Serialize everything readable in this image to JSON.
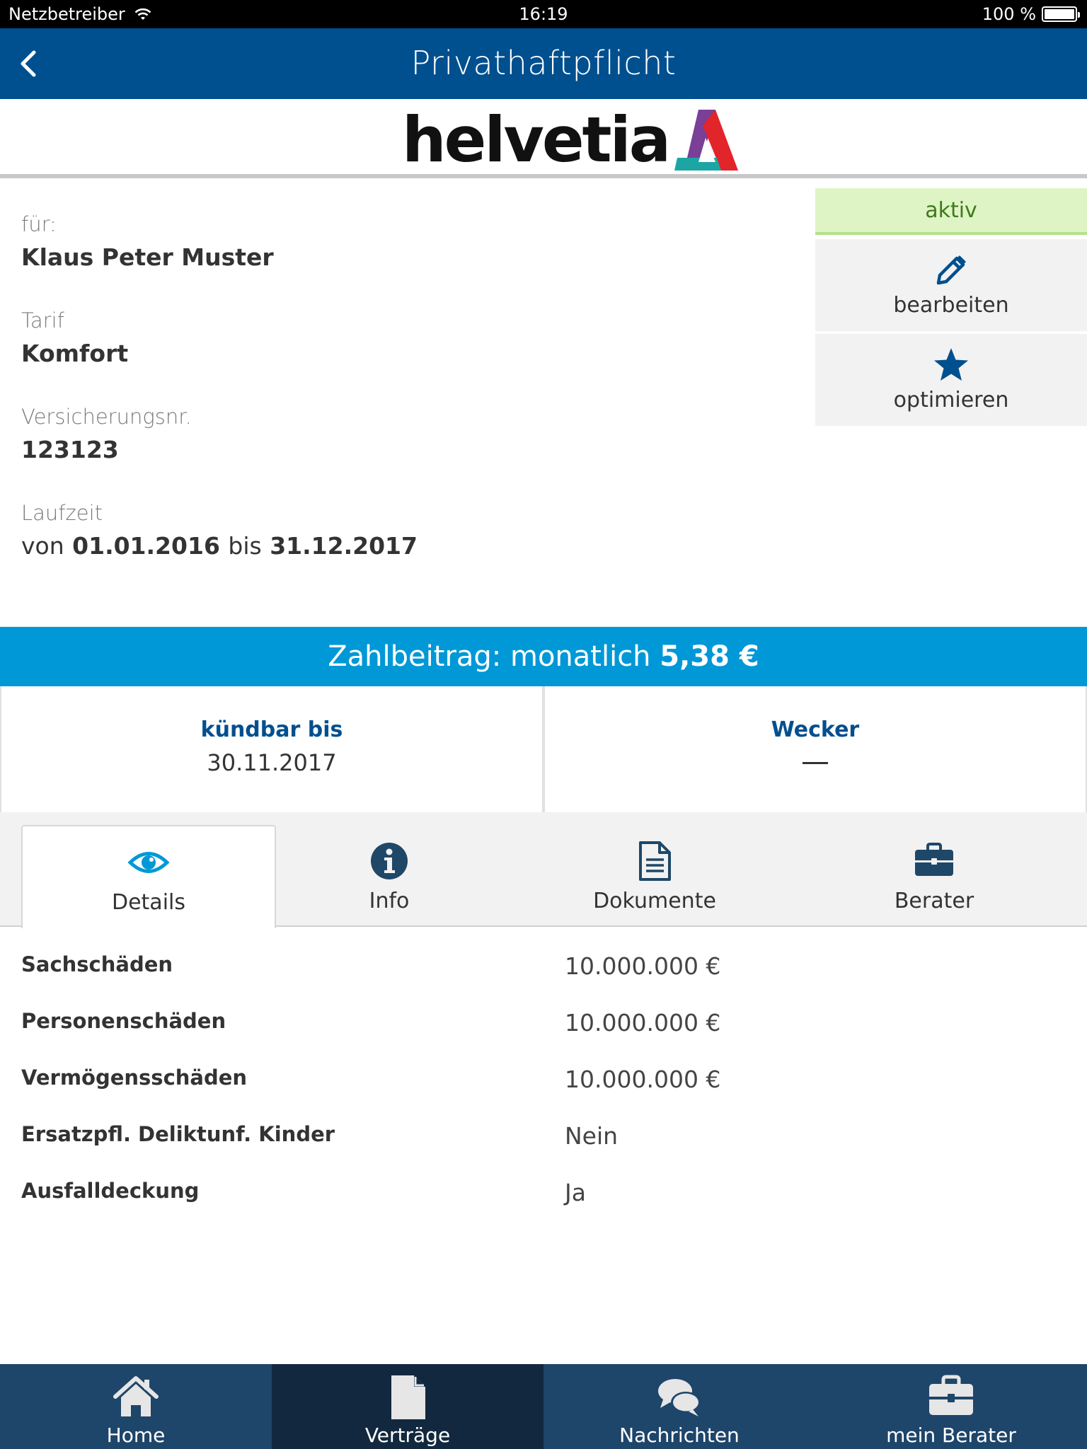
{
  "status_bar": {
    "carrier": "Netzbetreiber",
    "time": "16:19",
    "battery": "100 %"
  },
  "nav": {
    "title": "Privathaftpflicht",
    "back_icon": "chevron-left-icon"
  },
  "brand": {
    "name": "helvetia",
    "colors": {
      "purple": "#7a3f96",
      "red": "#e2242b",
      "teal": "#1ca6a3"
    }
  },
  "contract": {
    "holder_label": "für:",
    "holder_value": "Klaus Peter Muster",
    "tariff_label": "Tarif",
    "tariff_value": "Komfort",
    "policy_label": "Versicherungsnr.",
    "policy_value": "123123",
    "term_label": "Laufzeit",
    "term_from_word": "von",
    "term_from": "01.01.2016",
    "term_to_word": "bis",
    "term_to": "31.12.2017"
  },
  "actions": {
    "status": "aktiv",
    "edit_label": "bearbeiten",
    "optimize_label": "optimieren"
  },
  "payment": {
    "label": "Zahlbeitrag: monatlich",
    "amount": "5,38 €"
  },
  "cards": {
    "cancel_label": "kündbar bis",
    "cancel_value": "30.11.2017",
    "alarm_label": "Wecker"
  },
  "tabs": [
    {
      "label": "Details",
      "icon": "eye-icon"
    },
    {
      "label": "Info",
      "icon": "info-icon"
    },
    {
      "label": "Dokumente",
      "icon": "document-icon"
    },
    {
      "label": "Berater",
      "icon": "briefcase-icon"
    }
  ],
  "details": [
    {
      "key": "Sachschäden",
      "value": "10.000.000 €"
    },
    {
      "key": "Personenschäden",
      "value": "10.000.000 €"
    },
    {
      "key": "Vermögensschäden",
      "value": "10.000.000 €"
    },
    {
      "key": "Ersatzpfl. Deliktunf. Kinder",
      "value": "Nein"
    },
    {
      "key": "Ausfalldeckung",
      "value": "Ja"
    }
  ],
  "bottom_nav": [
    {
      "label": "Home",
      "icon": "home-icon"
    },
    {
      "label": "Verträge",
      "icon": "file-icon"
    },
    {
      "label": "Nachrichten",
      "icon": "chat-icon"
    },
    {
      "label": "mein Berater",
      "icon": "briefcase-icon"
    }
  ],
  "colors": {
    "nav_blue": "#004f8f",
    "accent_blue": "#0098d6",
    "status_green_bg": "#dff4c4",
    "bottom_bar": "#1e456a"
  }
}
